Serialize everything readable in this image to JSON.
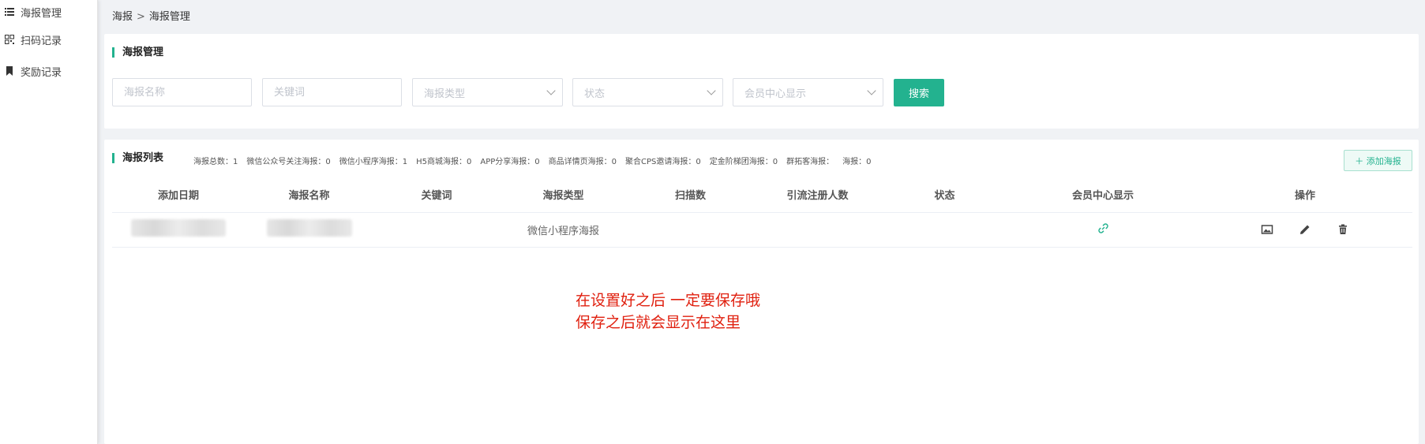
{
  "sidebar": {
    "items": [
      {
        "label": "海报管理",
        "icon": "list-icon"
      },
      {
        "label": "扫码记录",
        "icon": "qrcode-icon"
      },
      {
        "label": "奖励记录",
        "icon": "bookmark-icon"
      }
    ]
  },
  "breadcrumb": {
    "root": "海报",
    "separator": ">",
    "current": "海报管理"
  },
  "search_card": {
    "title": "海报管理",
    "poster_name_placeholder": "海报名称",
    "keyword_placeholder": "关键词",
    "poster_type_placeholder": "海报类型",
    "status_placeholder": "状态",
    "member_center_placeholder": "会员中心显示",
    "search_label": "搜索"
  },
  "list_card": {
    "title": "海报列表",
    "stats": [
      "海报总数：1",
      "微信公众号关注海报：0",
      "微信小程序海报：1",
      "H5商城海报：0",
      "APP分享海报：0",
      "商品详情页海报：0",
      "聚合CPS邀请海报：0",
      "定金阶梯团海报：0",
      "群拓客海报：",
      "海报：0"
    ],
    "add_label": "＋ 添加海报",
    "columns": [
      "添加日期",
      "海报名称",
      "关键词",
      "海报类型",
      "扫描数",
      "引流注册人数",
      "状态",
      "会员中心显示",
      "操作"
    ],
    "rows": [
      {
        "poster_type": "微信小程序海报"
      }
    ]
  },
  "annotation": {
    "line1": "在设置好之后 一定要保存哦",
    "line2": "保存之后就会显示在这里"
  },
  "colors": {
    "accent": "#23b28f",
    "note": "#e0200f"
  }
}
